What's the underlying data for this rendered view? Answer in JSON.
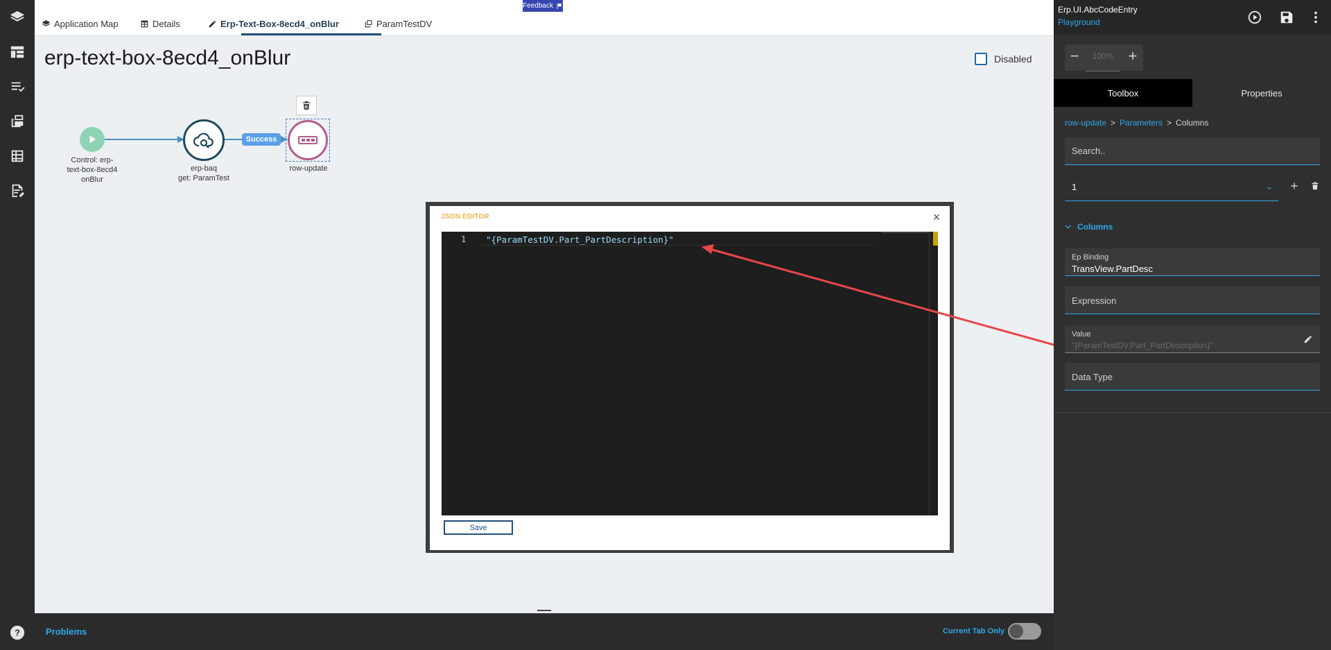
{
  "tabs": [
    {
      "label": "Application Map",
      "icon": "layers-icon"
    },
    {
      "label": "Details",
      "icon": "table-icon"
    },
    {
      "label": "Erp-Text-Box-8ecd4_onBlur",
      "icon": "edit-icon",
      "active": true
    },
    {
      "label": "ParamTestDV",
      "icon": "copy-icon"
    }
  ],
  "feedback": {
    "label": "Feedback"
  },
  "page": {
    "title": "erp-text-box-8ecd4_onBlur",
    "disabled_label": "Disabled"
  },
  "flow": {
    "start": {
      "label_line1": "Control: erp-",
      "label_line2": "text-box-8ecd4",
      "label_line3": "onBlur"
    },
    "baq": {
      "label_line1": "erp-baq",
      "label_line2": "get: ParamTest"
    },
    "success_label": "Success",
    "row": {
      "label": "row-update"
    }
  },
  "json_editor": {
    "title": "JSON EDITOR",
    "close": "×",
    "line_number": "1",
    "code": "\"{ParamTestDV.Part_PartDescription}\"",
    "save_label": "Save"
  },
  "problems": {
    "label": "Problems",
    "current_tab_only": "Current Tab Only"
  },
  "right_panel": {
    "title": "Erp.UI.AbcCodeEntry",
    "subtitle": "Playground",
    "zoom": {
      "minus": "−",
      "value": "100%",
      "plus": "+"
    },
    "tabs": {
      "toolbox": "Toolbox",
      "properties": "Properties"
    },
    "breadcrumb": [
      "row-update",
      ">",
      "Parameters",
      ">",
      "Columns"
    ],
    "search_placeholder": "Search..",
    "selector_value": "1",
    "section_label": "Columns",
    "fields": {
      "ep_binding_label": "Ep Binding",
      "ep_binding_value": "TransView.PartDesc",
      "expression_placeholder": "Expression",
      "value_label": "Value",
      "value_value": "\"{ParamTestDV.Part_PartDescription}\"",
      "data_type_placeholder": "Data Type"
    }
  },
  "colors": {
    "accent": "#2ea8e6",
    "dark_bg": "#2b2b2b",
    "arrow": "#e8474a",
    "success": "#5a9fe8"
  }
}
